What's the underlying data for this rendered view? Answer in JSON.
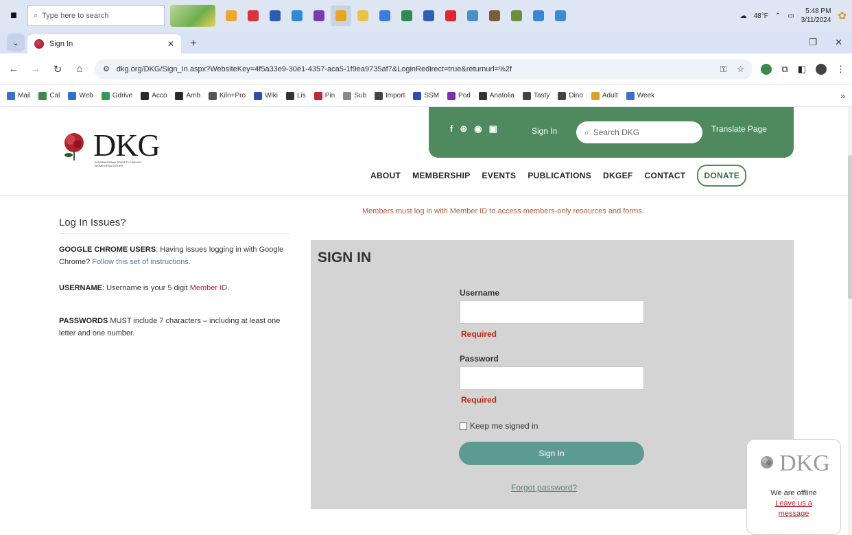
{
  "taskbar": {
    "search_placeholder": "Type here to search",
    "weather": "48°F",
    "time": "5:48 PM",
    "date": "3/11/2024",
    "apps": [
      {
        "name": "chrome-canary",
        "color": "#f0a62a"
      },
      {
        "name": "tv",
        "color": "#d9343a"
      },
      {
        "name": "store",
        "color": "#2b5db3"
      },
      {
        "name": "edge",
        "color": "#2a8bd8"
      },
      {
        "name": "onenote",
        "color": "#7a3ab0"
      },
      {
        "name": "chrome",
        "color": "#e8a51e"
      },
      {
        "name": "file-explorer",
        "color": "#e9c440"
      },
      {
        "name": "chrome-profile",
        "color": "#3c7be0"
      },
      {
        "name": "excel",
        "color": "#2f8a4f"
      },
      {
        "name": "word",
        "color": "#2f5fb5"
      },
      {
        "name": "youtube",
        "color": "#e1262e"
      },
      {
        "name": "photos",
        "color": "#4a90c8"
      },
      {
        "name": "library",
        "color": "#7a5d3c"
      },
      {
        "name": "charts",
        "color": "#6b8f3a"
      },
      {
        "name": "paint",
        "color": "#3a86d4"
      },
      {
        "name": "settings",
        "color": "#3c8ad8"
      }
    ]
  },
  "browser": {
    "tab_title": "Sign In",
    "url": "dkg.org/DKG/Sign_In.aspx?WebsiteKey=4f5a33e9-30e1-4357-aca5-1f9ea9735af7&LoginRedirect=true&returnurl=%2f",
    "bookmarks": [
      {
        "label": "Mail",
        "color": "#3b6fd8"
      },
      {
        "label": "Cal",
        "color": "#3d8a4a"
      },
      {
        "label": "Web",
        "color": "#2e6fd0"
      },
      {
        "label": "Gdrive",
        "color": "#2f9e55"
      },
      {
        "label": "Acco",
        "color": "#2a2a2a"
      },
      {
        "label": "Amb",
        "color": "#2a2a2a"
      },
      {
        "label": "Kiln+Pro",
        "color": "#555555"
      },
      {
        "label": "Wiki",
        "color": "#2a4fa8"
      },
      {
        "label": "Lis",
        "color": "#333333"
      },
      {
        "label": "Pin",
        "color": "#c82433"
      },
      {
        "label": "Sub",
        "color": "#888888"
      },
      {
        "label": "Import",
        "color": "#444444"
      },
      {
        "label": "SSM",
        "color": "#2b4cc0"
      },
      {
        "label": "Pod",
        "color": "#7b2fb0"
      },
      {
        "label": "Anatolia",
        "color": "#333333"
      },
      {
        "label": "Tasty",
        "color": "#444444"
      },
      {
        "label": "Dino",
        "color": "#444444"
      },
      {
        "label": "Adult",
        "color": "#e0a020"
      },
      {
        "label": "Week",
        "color": "#3a6fd0"
      }
    ]
  },
  "site": {
    "logo_text": "DKG",
    "logo_subtitle": "INTERNATIONAL SOCIETY FOR KEY WOMEN EDUCATORS",
    "signin_link": "Sign In",
    "search_placeholder": "Search DKG",
    "translate": "Translate Page",
    "nav": [
      "ABOUT",
      "MEMBERSHIP",
      "EVENTS",
      "PUBLICATIONS",
      "DKGEF",
      "CONTACT"
    ],
    "donate": "DONATE",
    "colors": {
      "green": "#4f8a5f",
      "teal": "#5e9a94",
      "panel": "#d4d4d4",
      "required": "#c0260f"
    }
  },
  "sidebar": {
    "title": "Log In Issues?",
    "chrome_label": "GOOGLE CHROME USERS",
    "chrome_text": ": Having issues logging in with Google Chrome? ",
    "chrome_link": "Follow this set of instructions.",
    "username_label": "USERNAME",
    "username_text": ": Username is your 5 digit ",
    "username_link": "Member ID",
    "username_end": ".",
    "password_label": "PASSWORDS",
    "password_text": " MUST include 7 characters – including at least one letter and one number."
  },
  "signin": {
    "notice": "Members must log in with Member ID to access members-only resources and forms.",
    "title": "SIGN IN",
    "username_label": "Username",
    "password_label": "Password",
    "required": "Required",
    "keep_signed_in": "Keep me signed in",
    "button": "Sign In",
    "forgot": "Forgot password?"
  },
  "chat": {
    "logo_text": "DKG",
    "status": "We are offline",
    "link": "Leave us a message"
  }
}
